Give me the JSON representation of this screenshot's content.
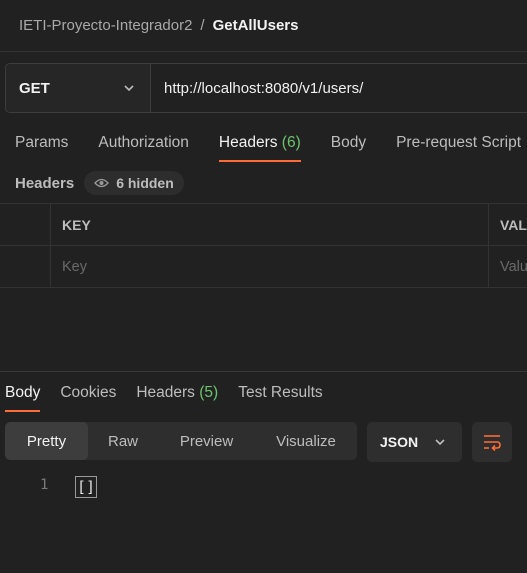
{
  "breadcrumb": {
    "parent": "IETI-Proyecto-Integrador2",
    "separator": "/",
    "current": "GetAllUsers"
  },
  "request": {
    "method": "GET",
    "url": "http://localhost:8080/v1/users/"
  },
  "request_tabs": [
    {
      "label": "Params"
    },
    {
      "label": "Authorization"
    },
    {
      "label": "Headers",
      "count": "(6)"
    },
    {
      "label": "Body"
    },
    {
      "label": "Pre-request Script"
    }
  ],
  "headers_section": {
    "label": "Headers",
    "hidden": "6 hidden"
  },
  "headers_table": {
    "key_header": "KEY",
    "value_header": "VALUE",
    "key_placeholder": "Key",
    "value_placeholder": "Value"
  },
  "response_tabs": [
    {
      "label": "Body"
    },
    {
      "label": "Cookies"
    },
    {
      "label": "Headers",
      "count": "(5)"
    },
    {
      "label": "Test Results"
    }
  ],
  "format_options": [
    "Pretty",
    "Raw",
    "Preview",
    "Visualize"
  ],
  "language": "JSON",
  "code": {
    "line": "1",
    "content": "[]"
  },
  "colors": {
    "accent": "#ff6c37",
    "count": "#6cc56c",
    "background": "#212121"
  }
}
